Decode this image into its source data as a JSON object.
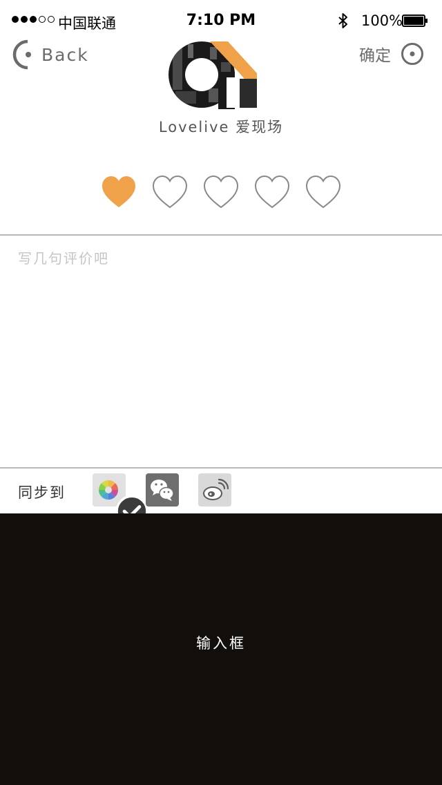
{
  "status_bar": {
    "carrier": "中国联通",
    "time": "7:10 PM",
    "battery": "100%",
    "signal_bars_filled": 3,
    "signal_bars_total": 5
  },
  "nav": {
    "back_label": "Back",
    "confirm_label": "确定"
  },
  "brand": {
    "name": "Lovelive 爱现场",
    "accent_color": "#f0a24a"
  },
  "rating": {
    "value": 1,
    "max": 5
  },
  "comment": {
    "placeholder": "写几句评价吧",
    "value": ""
  },
  "sync": {
    "label": "同步到",
    "targets": [
      {
        "icon": "wechat-moments-icon",
        "selected": true
      },
      {
        "icon": "wechat-icon",
        "selected": false
      },
      {
        "icon": "weibo-icon",
        "selected": false
      }
    ]
  },
  "keyboard": {
    "label": "输入框",
    "background": "#120e0b"
  }
}
